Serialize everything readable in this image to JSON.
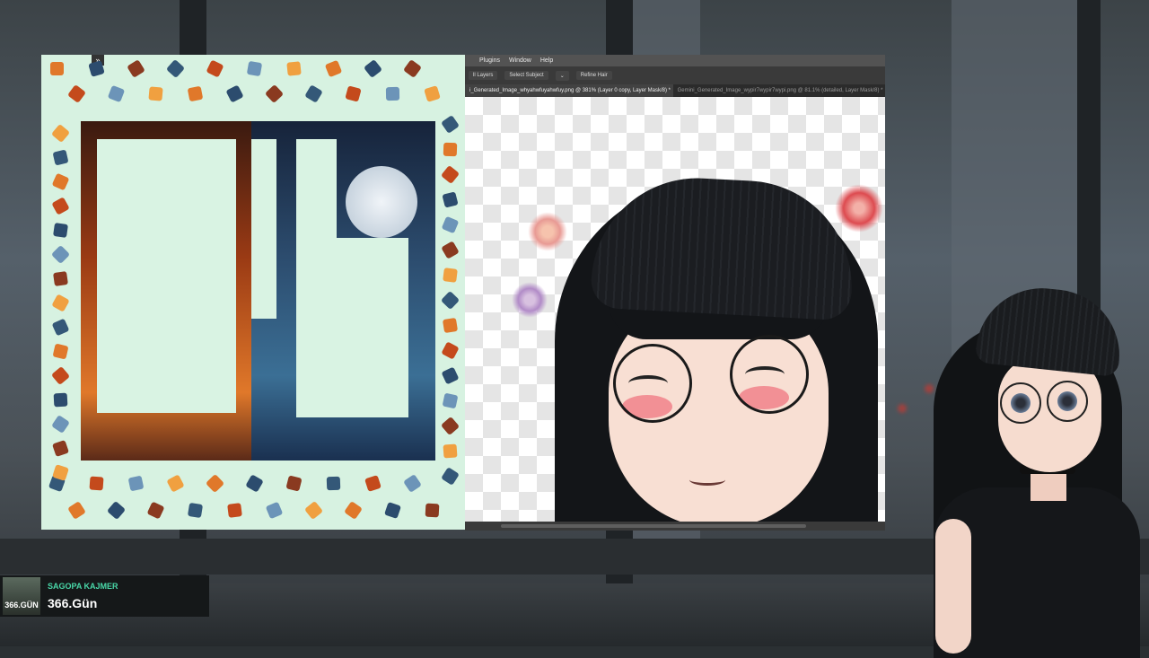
{
  "stream": {
    "now_playing": {
      "artist": "SAGOPA KAJMER",
      "title": "366.Gün",
      "art_label": "366.GÜN"
    }
  },
  "puzzle_window": {
    "collapse_glyph": "»",
    "colors": {
      "background": "#d7f2e1",
      "fire": "#e0782a",
      "sea": "#2c4c6e"
    }
  },
  "photoshop": {
    "menu": [
      " ",
      "Plugins",
      "Window",
      "Help"
    ],
    "options": [
      "ll Layers",
      "Select Subject",
      "⌄",
      "Refine Hair"
    ],
    "tabs": [
      {
        "label": "i_Generated_Image_whyahwfuyahwfuy.png @ 381% (Layer 0 copy, Layer Mask/8) *",
        "active": true
      },
      {
        "label": "Gemini_Generated_Image_wypir7wypir7wypi.png @ 81.1% (detailed, Layer Mask/8) *",
        "active": false
      }
    ]
  },
  "colors": {
    "accent": "#49d7a8",
    "wall": "#3c4347"
  }
}
